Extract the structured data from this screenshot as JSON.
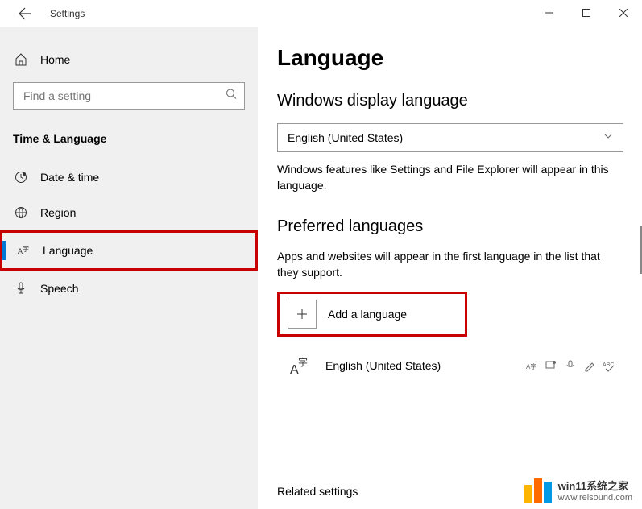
{
  "window": {
    "title": "Settings"
  },
  "sidebar": {
    "home": "Home",
    "search_placeholder": "Find a setting",
    "category": "Time & Language",
    "items": [
      {
        "label": "Date & time",
        "icon": "clock"
      },
      {
        "label": "Region",
        "icon": "globe"
      },
      {
        "label": "Language",
        "icon": "lang-char"
      },
      {
        "label": "Speech",
        "icon": "mic"
      }
    ]
  },
  "main": {
    "title": "Language",
    "display_section": {
      "heading": "Windows display language",
      "selected": "English (United States)",
      "description": "Windows features like Settings and File Explorer will appear in this language."
    },
    "preferred_section": {
      "heading": "Preferred languages",
      "description": "Apps and websites will appear in the first language in the list that they support.",
      "add_label": "Add a language",
      "languages": [
        {
          "name": "English (United States)"
        }
      ]
    },
    "related_heading": "Related settings"
  },
  "watermark": {
    "brand": "win11系统之家",
    "url": "www.relsound.com"
  }
}
